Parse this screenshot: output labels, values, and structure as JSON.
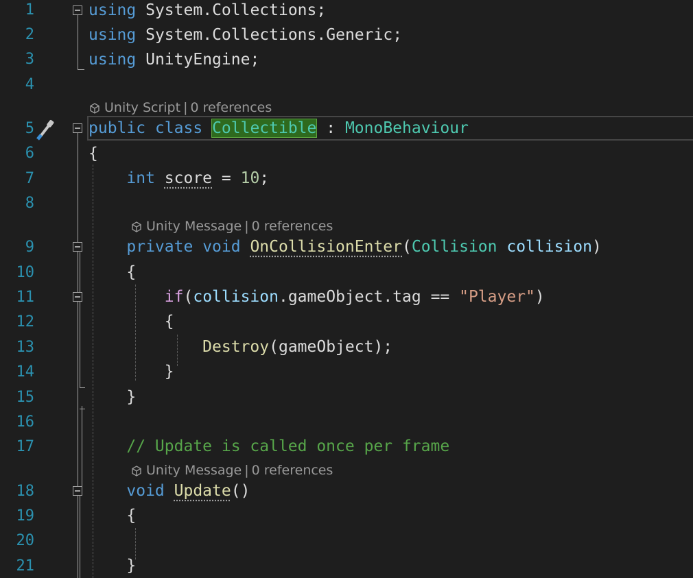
{
  "line_numbers": [
    "1",
    "2",
    "3",
    "4",
    "5",
    "6",
    "7",
    "8",
    "9",
    "10",
    "11",
    "12",
    "13",
    "14",
    "15",
    "16",
    "17",
    "18",
    "19",
    "20",
    "21"
  ],
  "codelens": [
    {
      "kind": "Unity Script",
      "refs": "0 references"
    },
    {
      "kind": "Unity Message",
      "refs": "0 references"
    },
    {
      "kind": "Unity Message",
      "refs": "0 references"
    }
  ],
  "code": {
    "l1": {
      "kw": "using",
      "ns1": "System",
      "dot": ".",
      "ns2": "Collections",
      "semi": ";"
    },
    "l2": {
      "kw": "using",
      "ns1": "System",
      "dot1": ".",
      "ns2": "Collections",
      "dot2": ".",
      "ns3": "Generic",
      "semi": ";"
    },
    "l3": {
      "kw": "using",
      "ns1": "UnityEngine",
      "semi": ";"
    },
    "l5": {
      "kw1": "public",
      "kw2": "class",
      "name": "Collectible",
      "colon": " : ",
      "base": "MonoBehaviour"
    },
    "l6": {
      "brace": "{"
    },
    "l7": {
      "type": "int",
      "name": "score",
      "eq": " = ",
      "num": "10",
      "semi": ";"
    },
    "l9": {
      "kw1": "private",
      "kw2": "void",
      "fn": "OnCollisionEnter",
      "open": "(",
      "ptype": "Collision",
      "pname": "collision",
      "close": ")"
    },
    "l10": {
      "brace": "{"
    },
    "l11": {
      "kw": "if",
      "open": "(",
      "obj": "collision",
      "dot1": ".",
      "prop1": "gameObject",
      "dot2": ".",
      "prop2": "tag",
      "op": " == ",
      "str": "\"Player\"",
      "close": ")"
    },
    "l12": {
      "brace": "{"
    },
    "l13": {
      "fn": "Destroy",
      "open": "(",
      "arg": "gameObject",
      "close": ");"
    },
    "l14": {
      "brace": "}"
    },
    "l15": {
      "brace": "}"
    },
    "l17": {
      "comment": "// Update is called once per frame"
    },
    "l18": {
      "kw": "void",
      "fn": "Update",
      "parens": "()"
    },
    "l19": {
      "brace": "{"
    },
    "l21": {
      "brace": "}"
    }
  },
  "icons": {
    "quick_actions": "screwdriver-brush-icon",
    "codelens": "cube-icon",
    "fold": "collapse-icon"
  },
  "colors": {
    "background": "#1e1e1e",
    "line_number": "#2b91af",
    "keyword": "#569cd6",
    "type": "#4ec9b0",
    "method": "#dcdcaa",
    "comment": "#57a64a",
    "string": "#d69d85",
    "number": "#b5cea8",
    "control": "#d8a0df"
  }
}
